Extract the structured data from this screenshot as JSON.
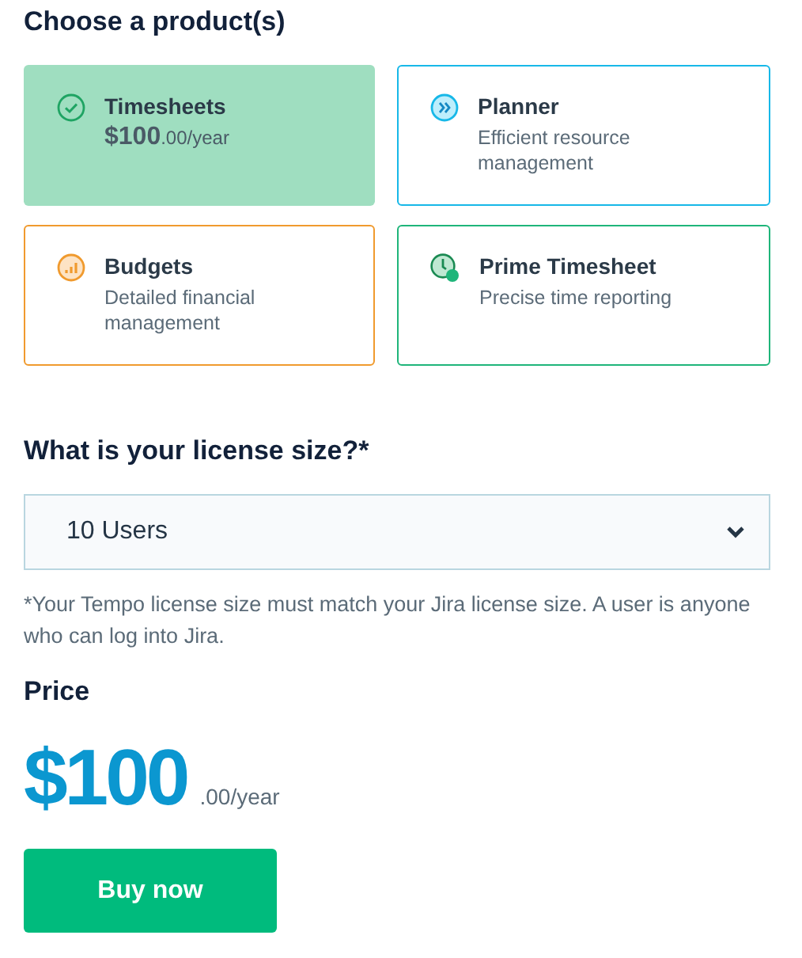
{
  "products_heading": "Choose a product(s)",
  "products": [
    {
      "kind": "check",
      "name": "Timesheets",
      "selected": true,
      "color": "#9fdec0",
      "price_main": "$100",
      "price_suffix": ".00/year"
    },
    {
      "kind": "chevrons",
      "name": "Planner",
      "selected": false,
      "color": "#17b8e8",
      "description": "Efficient resource management"
    },
    {
      "kind": "chart",
      "name": "Budgets",
      "selected": false,
      "color": "#f09a2e",
      "description": "Detailed financial management"
    },
    {
      "kind": "clock",
      "name": "Prime Timesheet",
      "selected": false,
      "color": "#1fb57a",
      "description": "Precise time reporting"
    }
  ],
  "license": {
    "heading": "What is your license size?*",
    "value": "10 Users",
    "note": "*Your Tempo license size must match your Jira license size. A user is anyone who can log into Jira."
  },
  "price": {
    "heading": "Price",
    "amount": "$100",
    "suffix": ".00/year"
  },
  "buy_button": "Buy now"
}
